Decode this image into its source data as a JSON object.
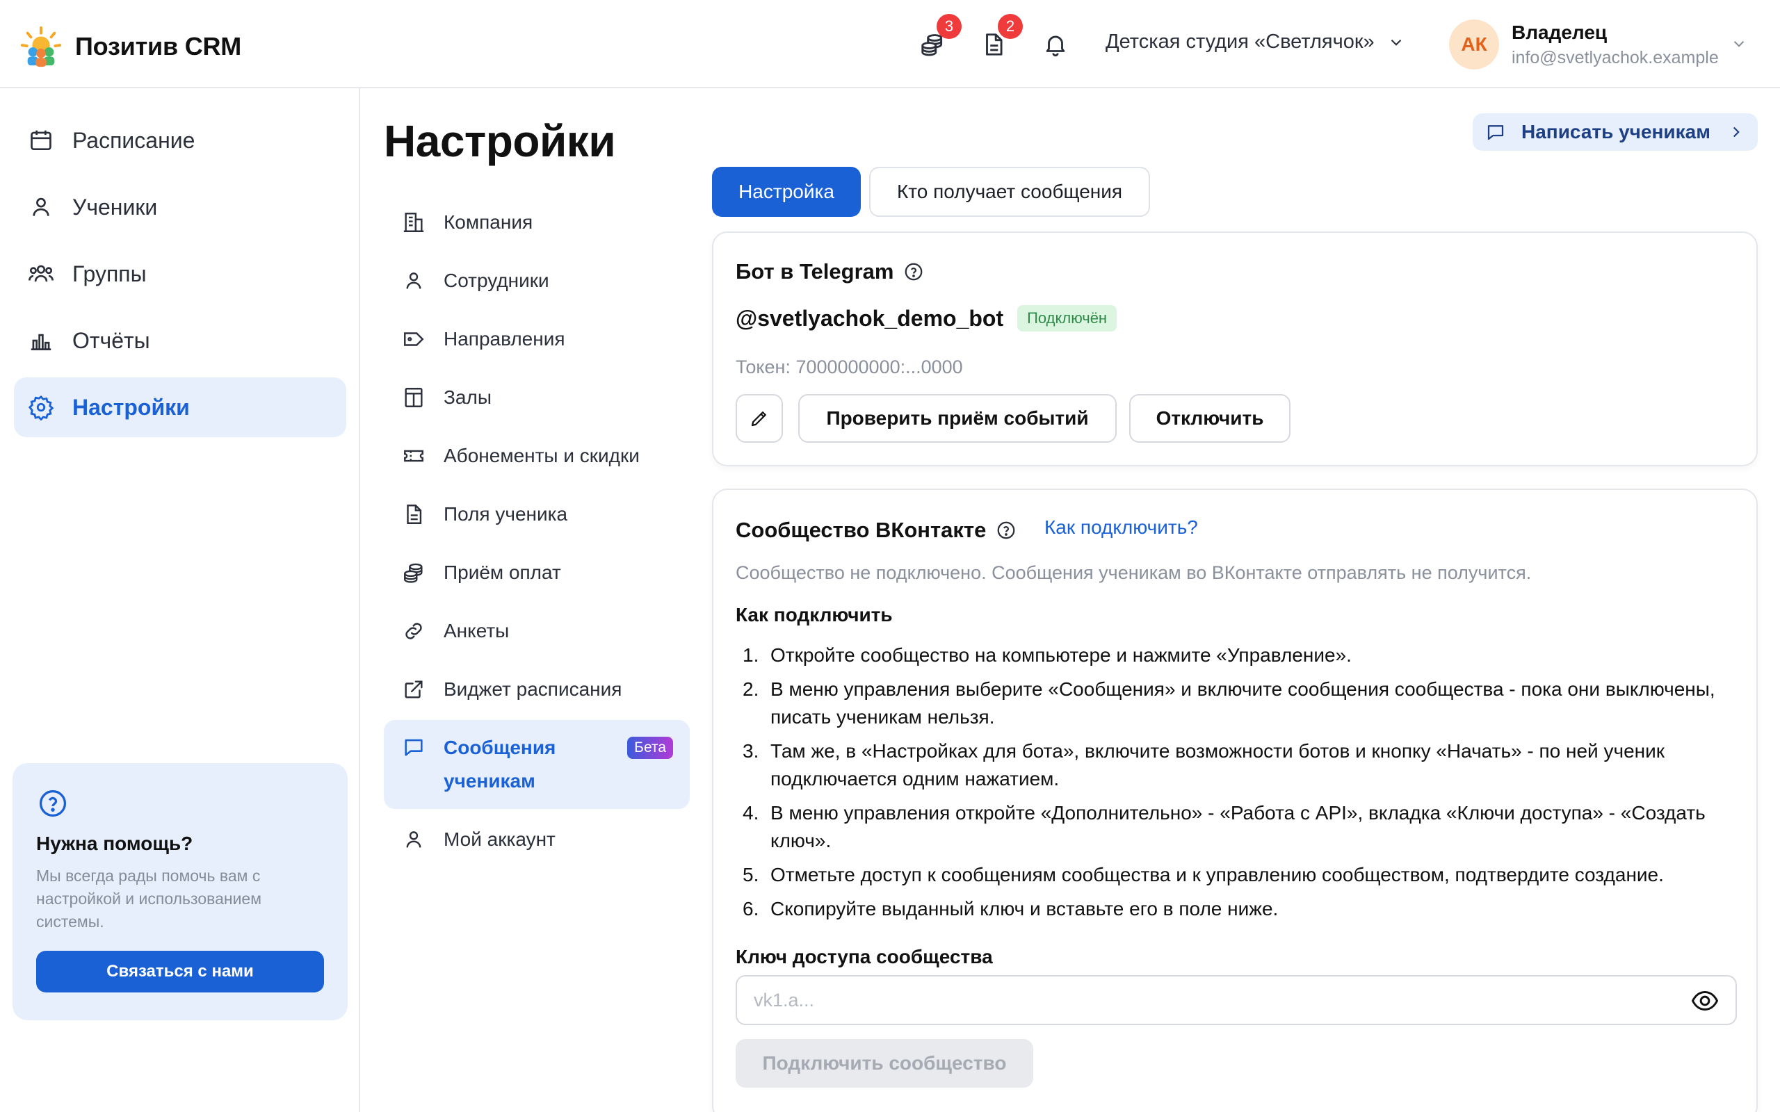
{
  "header": {
    "app_name": "Позитив CRM",
    "payments_badge": "3",
    "documents_badge": "2",
    "studio_name": "Детская студия «Светлячок»",
    "user": {
      "initials": "АК",
      "role": "Владелец",
      "email": "info@svetlyachok.example"
    }
  },
  "sidebar": {
    "items": [
      {
        "label": "Расписание",
        "icon": "calendar-icon"
      },
      {
        "label": "Ученики",
        "icon": "user-icon"
      },
      {
        "label": "Группы",
        "icon": "users-icon"
      },
      {
        "label": "Отчёты",
        "icon": "chart-icon"
      },
      {
        "label": "Настройки",
        "icon": "gear-icon",
        "active": true
      }
    ],
    "help": {
      "title": "Нужна помощь?",
      "text": "Мы всегда рады помочь вам с настройкой и использованием системы.",
      "button": "Связаться с нами"
    }
  },
  "page": {
    "title": "Настройки",
    "write_students": "Написать ученикам"
  },
  "settings_menu": [
    {
      "label": "Компания",
      "icon": "building-icon"
    },
    {
      "label": "Сотрудники",
      "icon": "user-icon"
    },
    {
      "label": "Направления",
      "icon": "tag-icon"
    },
    {
      "label": "Залы",
      "icon": "room-icon"
    },
    {
      "label": "Абонементы и скидки",
      "icon": "ticket-icon"
    },
    {
      "label": "Поля ученика",
      "icon": "document-icon"
    },
    {
      "label": "Приём оплат",
      "icon": "coins-icon"
    },
    {
      "label": "Анкеты",
      "icon": "link-icon"
    },
    {
      "label": "Виджет расписания",
      "icon": "external-link-icon"
    },
    {
      "label": "Сообщения ученикам",
      "icon": "message-icon",
      "active": true,
      "badge": "Бета"
    },
    {
      "label": "Мой аккаунт",
      "icon": "user-icon"
    }
  ],
  "tabs": [
    {
      "label": "Настройка",
      "active": true
    },
    {
      "label": "Кто получает сообщения",
      "active": false
    }
  ],
  "telegram": {
    "title": "Бот в Telegram",
    "handle": "@svetlyachok_demo_bot",
    "status": "Подключён",
    "token": "Токен: 7000000000:...0000",
    "check_button": "Проверить приём событий",
    "disconnect_button": "Отключить"
  },
  "vk": {
    "title": "Сообщество ВКонтакте",
    "how_link": "Как подключить?",
    "note": "Сообщество не подключено. Сообщения ученикам во ВКонтакте отправлять не получится.",
    "how_title": "Как подключить",
    "steps": [
      "Откройте сообщество на компьютере и нажмите «Управление».",
      "В меню управления выберите «Сообщения» и включите сообщения сообщества - пока они выключены, писать ученикам нельзя.",
      "Там же, в «Настройках для бота», включите возможности ботов и кнопку «Начать» - по ней ученик подключается одним нажатием.",
      "В меню управления откройте «Дополнительно» - «Работа с API», вкладка «Ключи доступа» - «Создать ключ».",
      "Отметьте доступ к сообщениям сообщества и к управлению сообществом, подтвердите создание.",
      "Скопируйте выданный ключ и вставьте его в поле ниже."
    ],
    "key_label": "Ключ доступа сообщества",
    "key_placeholder": "vk1.a...",
    "key_value": "",
    "connect_button": "Подключить сообщество"
  },
  "colors": {
    "accent": "#1a61d6",
    "active_bg": "#e7effd",
    "badge": "#ef3b3b",
    "status_ok_bg": "#dbf5e0",
    "status_ok_text": "#2d8a47"
  }
}
